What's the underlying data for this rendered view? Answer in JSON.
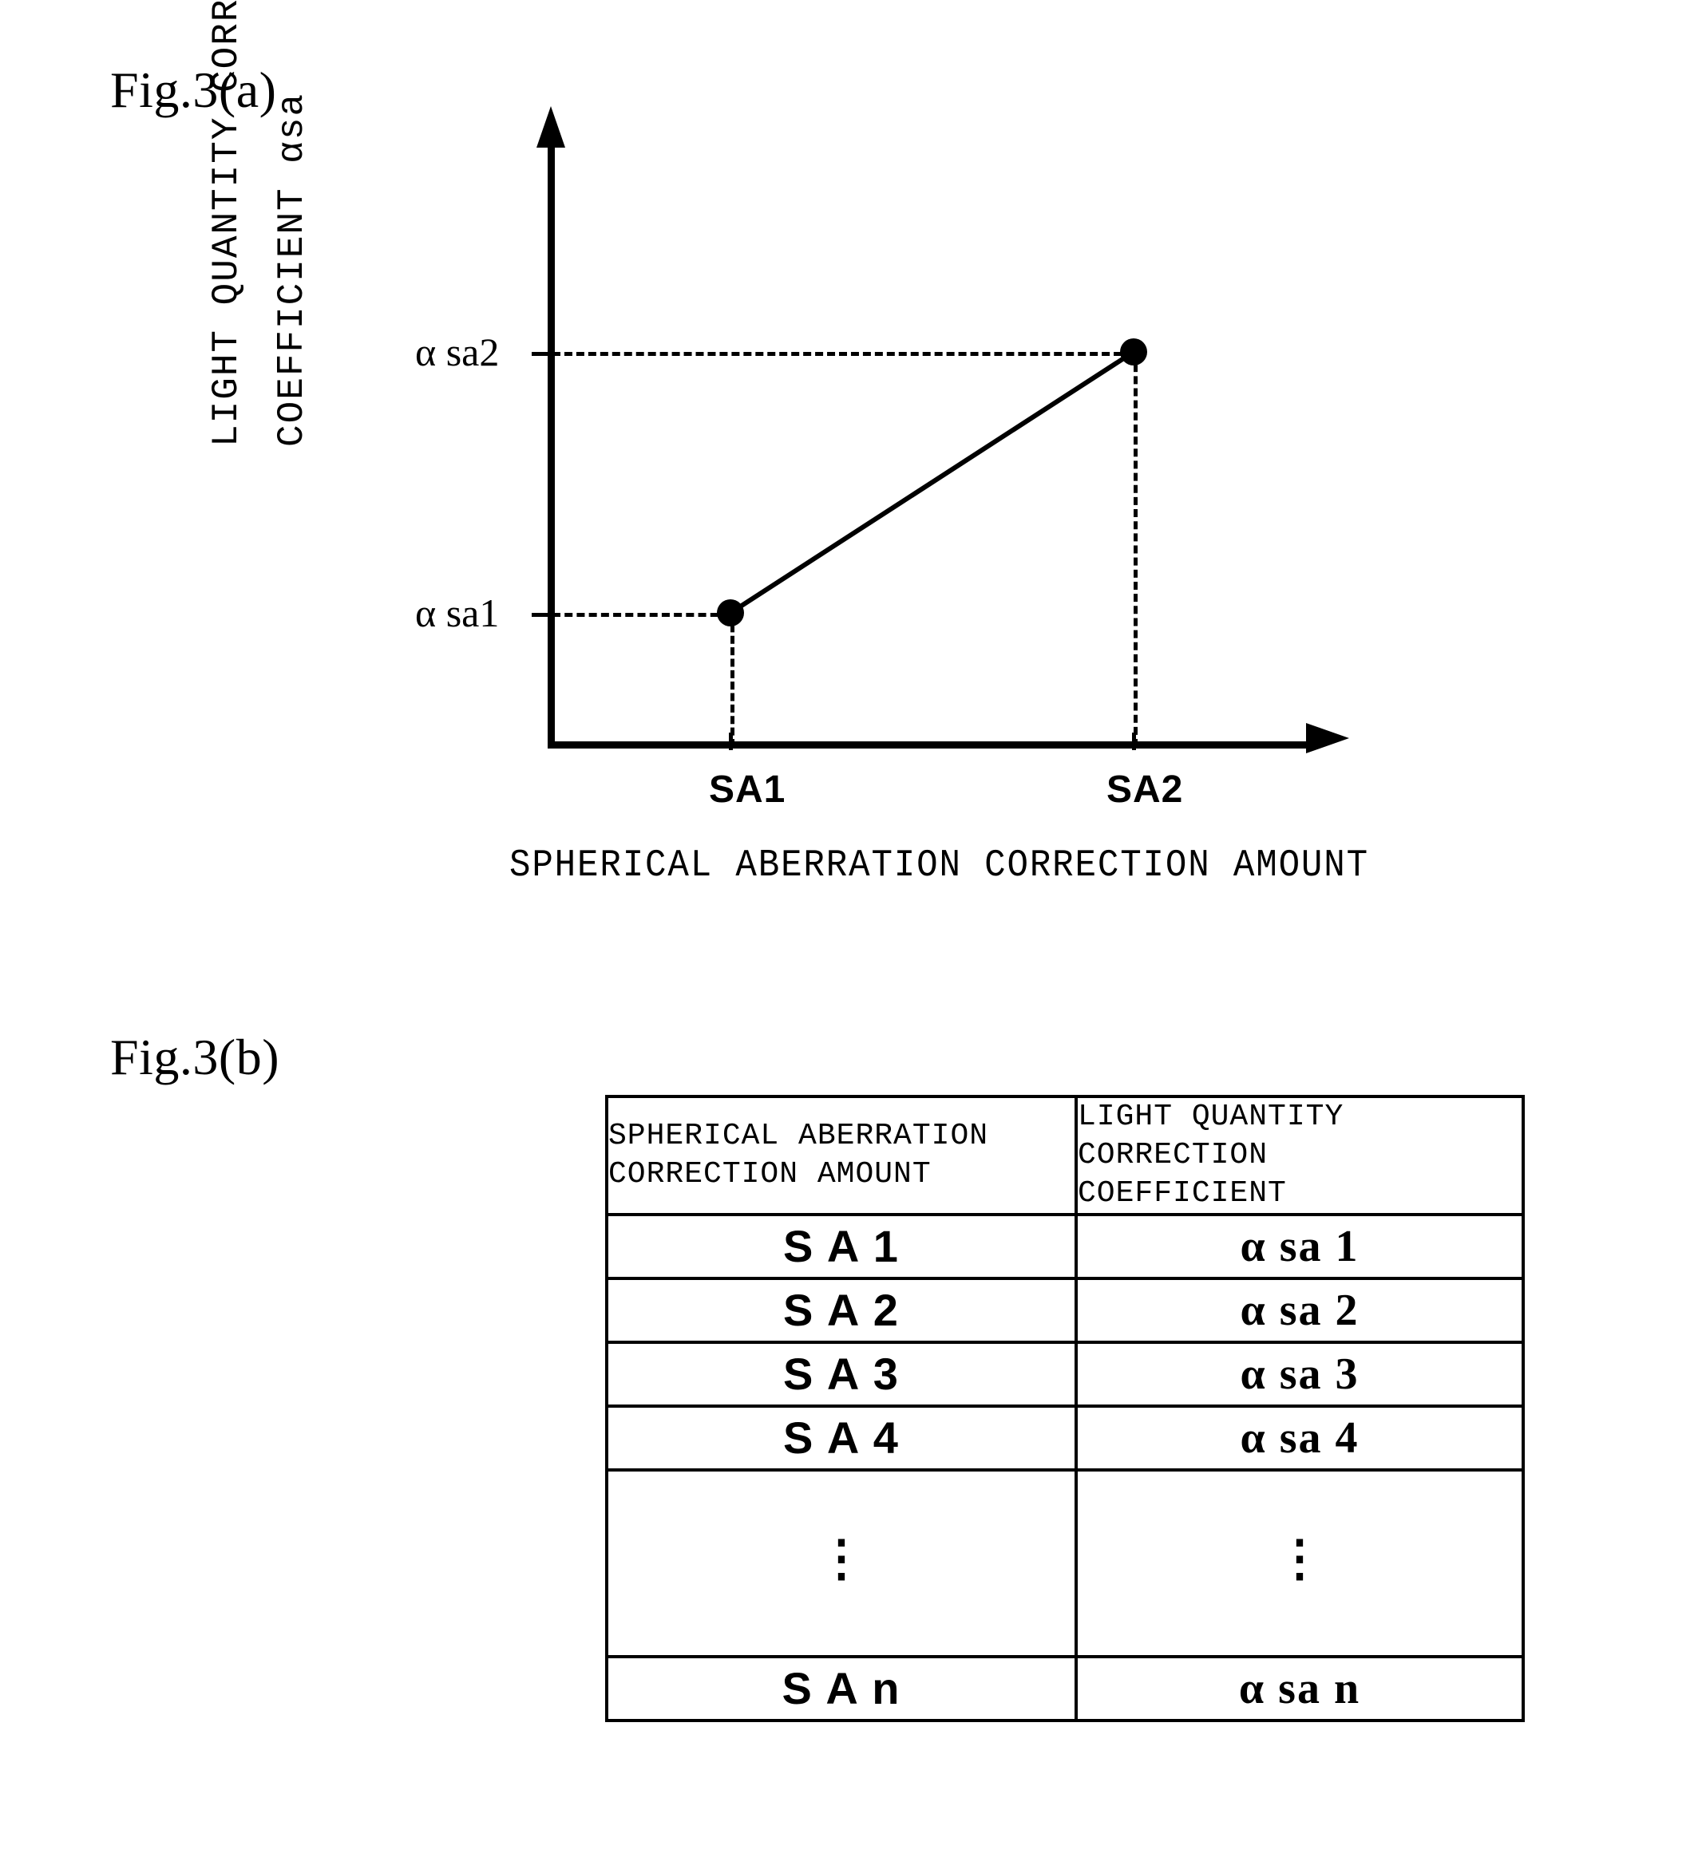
{
  "figures": {
    "a": {
      "label": "Fig.3(a)"
    },
    "b": {
      "label": "Fig.3(b)"
    }
  },
  "chart_data": {
    "type": "line",
    "title": "",
    "xlabel": "SPHERICAL ABERRATION CORRECTION AMOUNT",
    "ylabel_line1": "LIGHT  QUANTITY  CORRECTION",
    "ylabel_line2": "COEFFICIENT αsa",
    "x_tick_labels": [
      "SA1",
      "SA2"
    ],
    "y_tick_labels": [
      "α sa1",
      "α sa2"
    ],
    "points": [
      {
        "x_label": "SA1",
        "y_label": "α sa1",
        "x": 1,
        "y": 1
      },
      {
        "x_label": "SA2",
        "y_label": "α sa2",
        "x": 2,
        "y": 2
      }
    ],
    "series": [
      {
        "name": "light quantity correction coefficient",
        "x": [
          1,
          2
        ],
        "values": [
          1,
          2
        ]
      }
    ],
    "grid": false,
    "legend": false,
    "guide_lines": "dashed",
    "axis_arrows": true
  },
  "table": {
    "headers": {
      "left": [
        "SPHERICAL ABERRATION",
        "CORRECTION AMOUNT"
      ],
      "right": [
        "LIGHT  QUANTITY",
        "CORRECTION",
        "COEFFICIENT"
      ]
    },
    "rows": [
      {
        "left": "S A 1",
        "right": "α sa 1"
      },
      {
        "left": "S A 2",
        "right": "α sa 2"
      },
      {
        "left": "S A 3",
        "right": "α sa 3"
      },
      {
        "left": "S A 4",
        "right": "α sa 4"
      },
      {
        "left": "⋮",
        "right": "⋮",
        "is_ellipsis": true
      },
      {
        "left": "S A n",
        "right": "α sa n"
      }
    ],
    "ellipsis_glyph": "⋮"
  },
  "colors": {
    "ink": "#000000",
    "paper": "#ffffff"
  }
}
